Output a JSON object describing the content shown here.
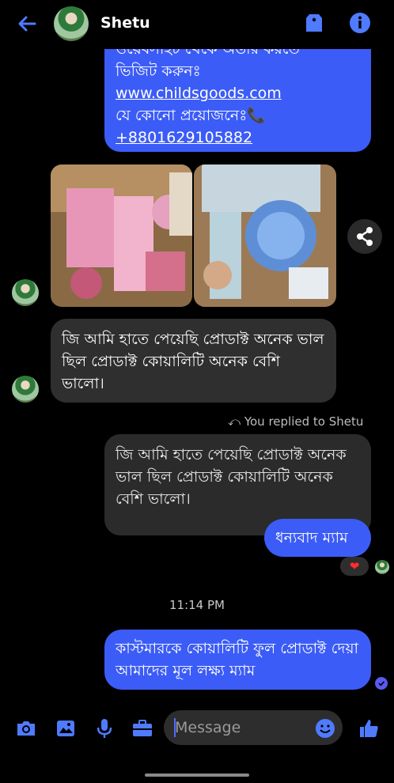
{
  "header": {
    "contact_name": "Shetu"
  },
  "messages": {
    "top_bubble": {
      "line_partial": "ওয়েবসাইট থেকে অর্ডার করতে",
      "line_visit": "ভিজিট করুনঃ",
      "link": "www.childsgoods.com",
      "line_need": "যে কোনো প্রয়োজনেঃ📞",
      "phone": "+8801629105882"
    },
    "received_1": "জি আমি হাতে পেয়েছি প্রোডাক্ট অনেক ভাল ছিল প্রোডাক্ট কোয়ালিটি অনেক বেশি ভালো।",
    "replied_label": "You replied to Shetu",
    "quoted": "জি আমি হাতে পেয়েছি প্রোডাক্ট অনেক ভাল ছিল প্রোডাক্ট কোয়ালিটি অনেক বেশি ভালো।",
    "sent_thanks": "ধন্যবাদ ম্যাম",
    "reaction": "❤",
    "time": "11:14 PM",
    "sent_final": "কাস্টমারকে কোয়ালিটি ফুল প্রোডাক্ট দেয়া আমাদের মূল লক্ষ্য ম্যাম"
  },
  "composer": {
    "placeholder": "Message"
  },
  "colors": {
    "accent": "#3c5cf7",
    "background": "#000000",
    "received_bubble": "#2f2f2f"
  },
  "icons": [
    "back-arrow-icon",
    "tag-icon",
    "info-icon",
    "share-icon",
    "camera-icon",
    "image-icon",
    "microphone-icon",
    "briefcase-icon",
    "emoji-icon",
    "thumbs-up-icon",
    "heart-icon",
    "seen-check-icon"
  ]
}
